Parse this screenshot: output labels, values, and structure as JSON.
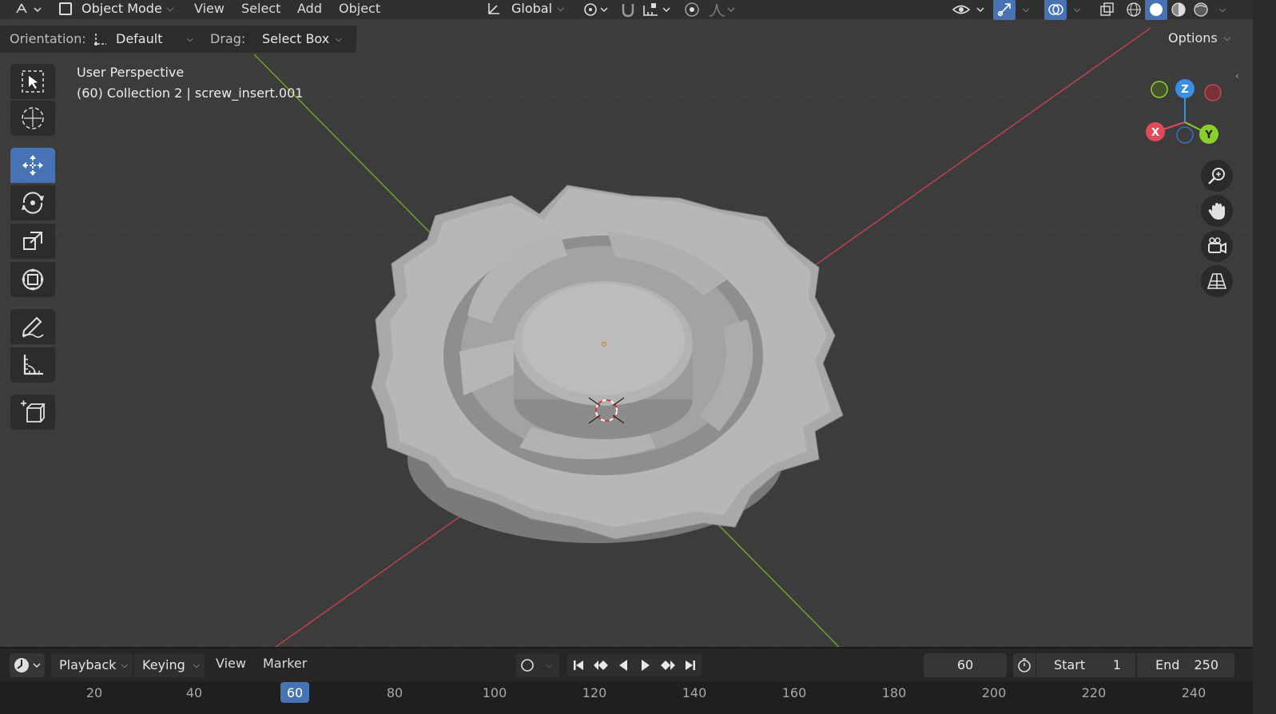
{
  "header": {
    "mode": "Object Mode",
    "menus": [
      "View",
      "Select",
      "Add",
      "Object"
    ],
    "transform_orientation": "Global"
  },
  "toolsettings": {
    "orientation_label": "Orientation:",
    "orientation_value": "Default",
    "drag_label": "Drag:",
    "drag_value": "Select Box",
    "options_label": "Options"
  },
  "viewport": {
    "hud_line1": "User Perspective",
    "hud_line2": "(60) Collection 2 | screw_insert.001",
    "gizmo": {
      "z": "Z",
      "x": "X",
      "y": "Y"
    }
  },
  "toolbar": {
    "tools": [
      "select-box",
      "cursor",
      "move",
      "rotate",
      "scale",
      "transform",
      "annotate",
      "measure",
      "add-cube"
    ],
    "active": "move"
  },
  "timeline": {
    "menus": [
      "Playback",
      "Keying",
      "View",
      "Marker"
    ],
    "current_frame": "60",
    "start_label": "Start",
    "start_value": "1",
    "end_label": "End",
    "end_value": "250",
    "ruler": [
      "20",
      "40",
      "60",
      "80",
      "100",
      "120",
      "140",
      "160",
      "180",
      "200",
      "220",
      "240"
    ]
  },
  "colors": {
    "accent": "#4772b3",
    "axis_x": "#e04b5c",
    "axis_y": "#8ccf2a",
    "axis_z": "#3a8ee6",
    "viewport_bg": "#3c3c3c"
  }
}
